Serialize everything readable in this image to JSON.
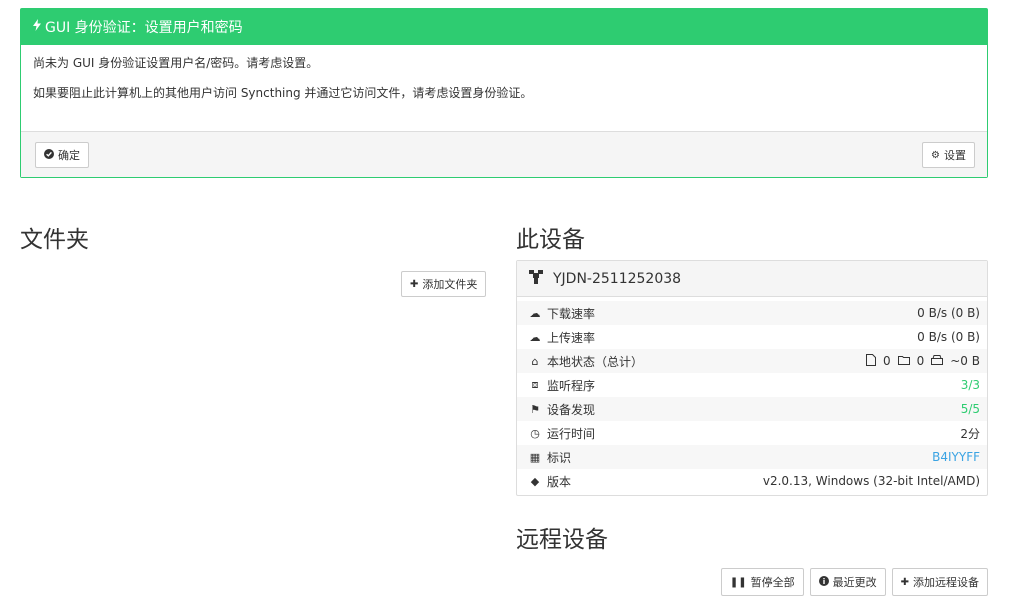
{
  "alert": {
    "title": "GUI 身份验证：设置用户和密码",
    "line1": "尚未为 GUI 身份验证设置用户名/密码。请考虑设置。",
    "line2": "如果要阻止此计算机上的其他用户访问 Syncthing 并通过它访问文件，请考虑设置身份验证。",
    "ok_label": "确定",
    "settings_label": "设置",
    "accent": "#2ecc71"
  },
  "folders": {
    "heading": "文件夹",
    "add_label": "添加文件夹"
  },
  "this_device": {
    "heading": "此设备",
    "name": "YJDN-2511252038",
    "rows": [
      {
        "icon": "cloud-download-icon",
        "label": "下载速率",
        "value": "0 B/s (0 B)"
      },
      {
        "icon": "cloud-upload-icon",
        "label": "上传速率",
        "value": "0 B/s (0 B)"
      },
      {
        "icon": "home-icon",
        "label": "本地状态（总计）",
        "value": ""
      },
      {
        "icon": "sitemap-icon",
        "label": "监听程序",
        "value": "3/3"
      },
      {
        "icon": "signpost-icon",
        "label": "设备发现",
        "value": "5/5"
      },
      {
        "icon": "clock-icon",
        "label": "运行时间",
        "value": "2分"
      },
      {
        "icon": "qrcode-icon",
        "label": "标识",
        "value": "B4IYYFF"
      },
      {
        "icon": "tag-icon",
        "label": "版本",
        "value": "v2.0.13, Windows (32-bit Intel/AMD)"
      }
    ],
    "local_state": {
      "files": "0",
      "dirs": "0",
      "size": "~0 B"
    }
  },
  "remote": {
    "heading": "远程设备",
    "pause_all": "暂停全部",
    "recent_changes": "最近更改",
    "add_remote": "添加远程设备"
  }
}
